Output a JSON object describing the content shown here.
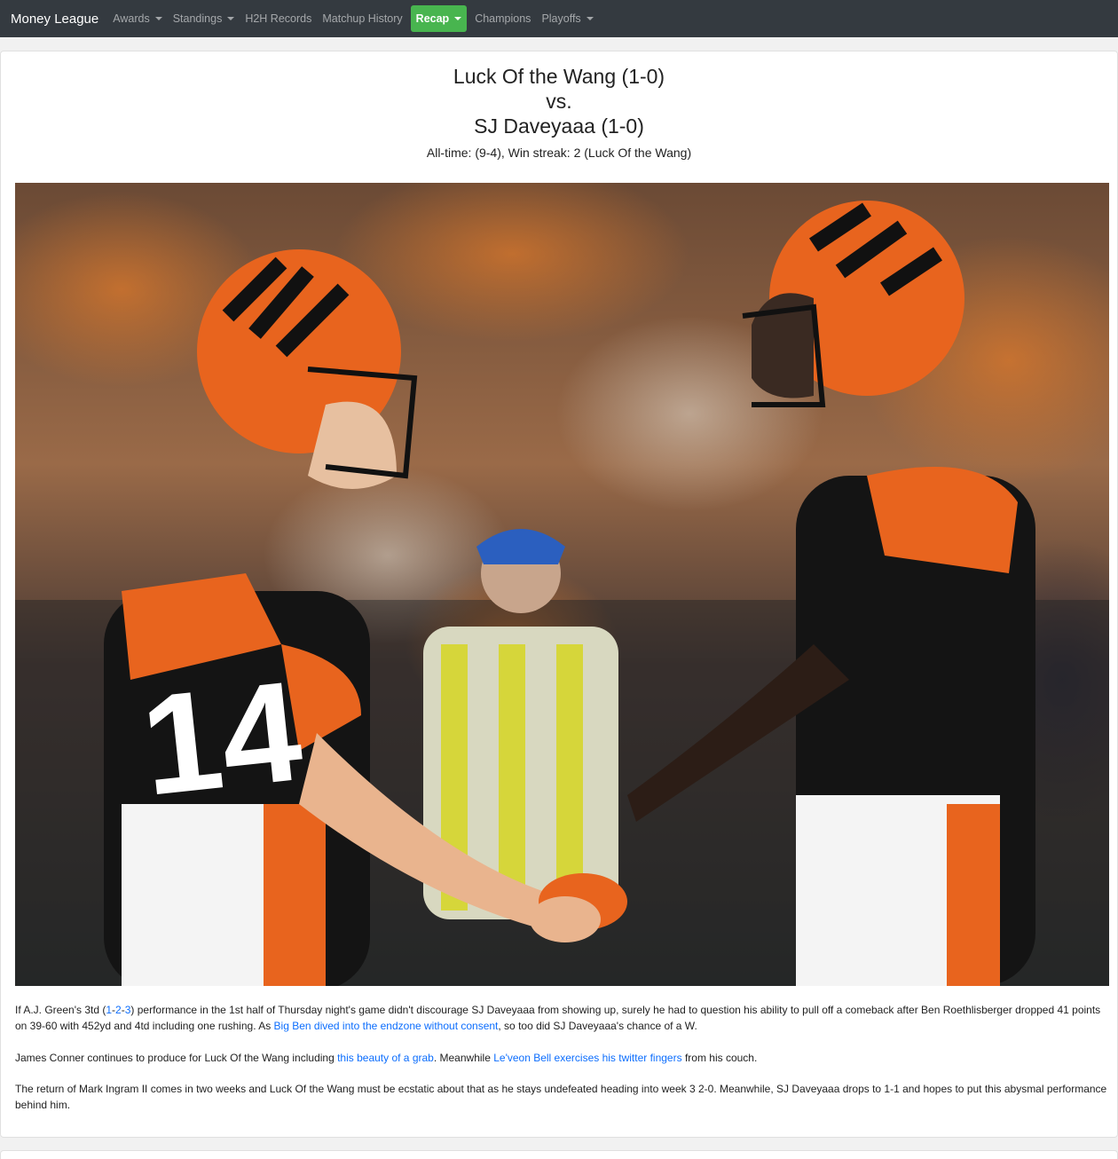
{
  "nav": {
    "brand": "Money League",
    "items": [
      {
        "label": "Awards",
        "dropdown": true
      },
      {
        "label": "Standings",
        "dropdown": true
      },
      {
        "label": "H2H Records",
        "dropdown": false
      },
      {
        "label": "Matchup History",
        "dropdown": false
      },
      {
        "label": "Recap",
        "dropdown": true,
        "active": true
      },
      {
        "label": "Champions",
        "dropdown": false
      },
      {
        "label": "Playoffs",
        "dropdown": true
      }
    ],
    "active_color": "#48b54f"
  },
  "matchup": {
    "team1": "Luck Of the Wang (1-0)",
    "vs": "vs.",
    "team2": "SJ Daveyaaa (1-0)",
    "alltime": "All-time: (9-4), Win streak: 2 (Luck Of the Wang)"
  },
  "hero": {
    "alt_subject": "bengals-players-handshake"
  },
  "recap": {
    "p1": {
      "t1": "If A.J. Green's 3td (",
      "l1": "1",
      "d1": "-",
      "l2": "2",
      "d2": "-",
      "l3": "3",
      "t2": ") performance in the 1st half of Thursday night's game didn't discourage SJ Daveyaaa from showing up, surely he had to question his ability to pull off a comeback after Ben Roethlisberger dropped 41 points on 39-60 with 452yd and 4td including one rushing. As ",
      "l4": "Big Ben dived into the endzone without consent",
      "t3": ", so too did SJ Daveyaaa's chance of a W."
    },
    "p2": {
      "t1": "James Conner continues to produce for Luck Of the Wang including ",
      "l1": "this beauty of a grab",
      "t2": ". Meanwhile ",
      "l2": "Le'veon Bell exercises his twitter fingers",
      "t3": " from his couch."
    },
    "p3": "The return of Mark Ingram II comes in two weeks and Luck Of the Wang must be ecstatic about that as he stays undefeated heading into week 3 2-0. Meanwhile, SJ Daveyaaa drops to 1-1 and hopes to put this abysmal performance behind him."
  }
}
